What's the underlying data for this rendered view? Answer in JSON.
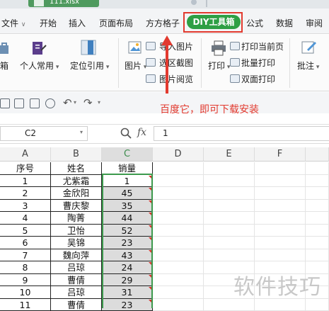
{
  "title_tab": {
    "filename": "111.xlsx"
  },
  "menu": {
    "items": [
      "文件",
      "开始",
      "插入",
      "页面布局",
      "方方格子",
      "DIY工具箱",
      "公式",
      "数据",
      "审阅"
    ],
    "active": "DIY工具箱"
  },
  "ribbon": {
    "big_buttons": [
      "箱",
      "个人常用",
      "定位引用",
      "图片",
      "打印",
      "批注"
    ],
    "image_group": [
      "导入图片",
      "选区截图",
      "图片阅览"
    ],
    "print_group": [
      "打印当前页",
      "批量打印",
      "双面打印"
    ]
  },
  "annotation": {
    "text": "百度它，即可下载安装",
    "color": "#e23a2f"
  },
  "formula_bar": {
    "name_box": "C2",
    "fx_label": "fx",
    "value": "1"
  },
  "sheet": {
    "columns": [
      "A",
      "B",
      "C",
      "D",
      "E",
      "F"
    ],
    "selected_column": "C",
    "rows": [
      {
        "A": "序号",
        "B": "姓名",
        "C": "销量"
      },
      {
        "A": "1",
        "B": "尤紫霜",
        "C": "1"
      },
      {
        "A": "2",
        "B": "金欣阳",
        "C": "45"
      },
      {
        "A": "3",
        "B": "曹庆黎",
        "C": "35"
      },
      {
        "A": "4",
        "B": "陶菁",
        "C": "44"
      },
      {
        "A": "5",
        "B": "卫怡",
        "C": "52"
      },
      {
        "A": "6",
        "B": "吴锦",
        "C": "23"
      },
      {
        "A": "7",
        "B": "魏向萍",
        "C": "43"
      },
      {
        "A": "8",
        "B": "吕琼",
        "C": "24"
      },
      {
        "A": "9",
        "B": "曹倩",
        "C": "29"
      },
      {
        "A": "10",
        "B": "吕琼",
        "C": "31"
      },
      {
        "A": "11",
        "B": "曹倩",
        "C": "23"
      }
    ]
  },
  "watermark": "软件技巧",
  "colors": {
    "accent_green": "#2e9f44",
    "highlight_red": "#e23a2f"
  }
}
